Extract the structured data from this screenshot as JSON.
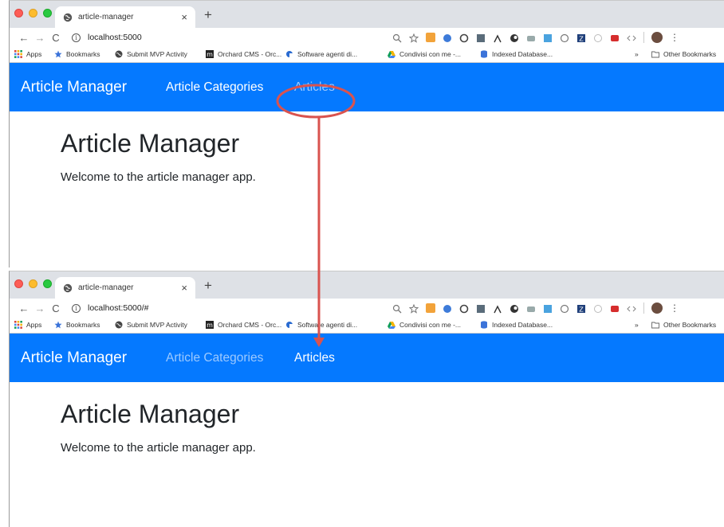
{
  "browser": {
    "tab_title": "article-manager",
    "tab_close": "×",
    "new_tab": "+",
    "nav": {
      "back": "←",
      "forward": "→",
      "reload": "C"
    },
    "info_icon": "i",
    "menu_dots": "⋮",
    "bookmarks": {
      "apps": "Apps",
      "bookmarks": "Bookmarks",
      "submit_mvp": "Submit MVP Activity",
      "orchard": "Orchard CMS - Orc...",
      "software": "Software agenti di...",
      "condivisi": "Condivisi con me -...",
      "indexed": "Indexed Database...",
      "overflow": "»",
      "other": "Other Bookmarks"
    }
  },
  "screens": {
    "before": {
      "url": "localhost:5000",
      "active_link": "articles"
    },
    "after": {
      "url": "localhost:5000/#",
      "active_link": "articles"
    }
  },
  "app": {
    "brand": "Article Manager",
    "link_categories": "Article Categories",
    "link_articles": "Articles",
    "heading": "Article Manager",
    "welcome": "Welcome to the article manager app."
  },
  "colors": {
    "navbar": "#0579ff",
    "annotation": "#d9534f",
    "inactive_link": "#9cc9ff"
  },
  "icons": [
    "back-arrow-icon",
    "forward-arrow-icon",
    "reload-icon",
    "info-icon",
    "zoom-icon",
    "star-icon",
    "menu-dots-icon",
    "apps-grid-icon",
    "globe-icon",
    "folder-icon",
    "database-icon",
    "drive-icon"
  ]
}
